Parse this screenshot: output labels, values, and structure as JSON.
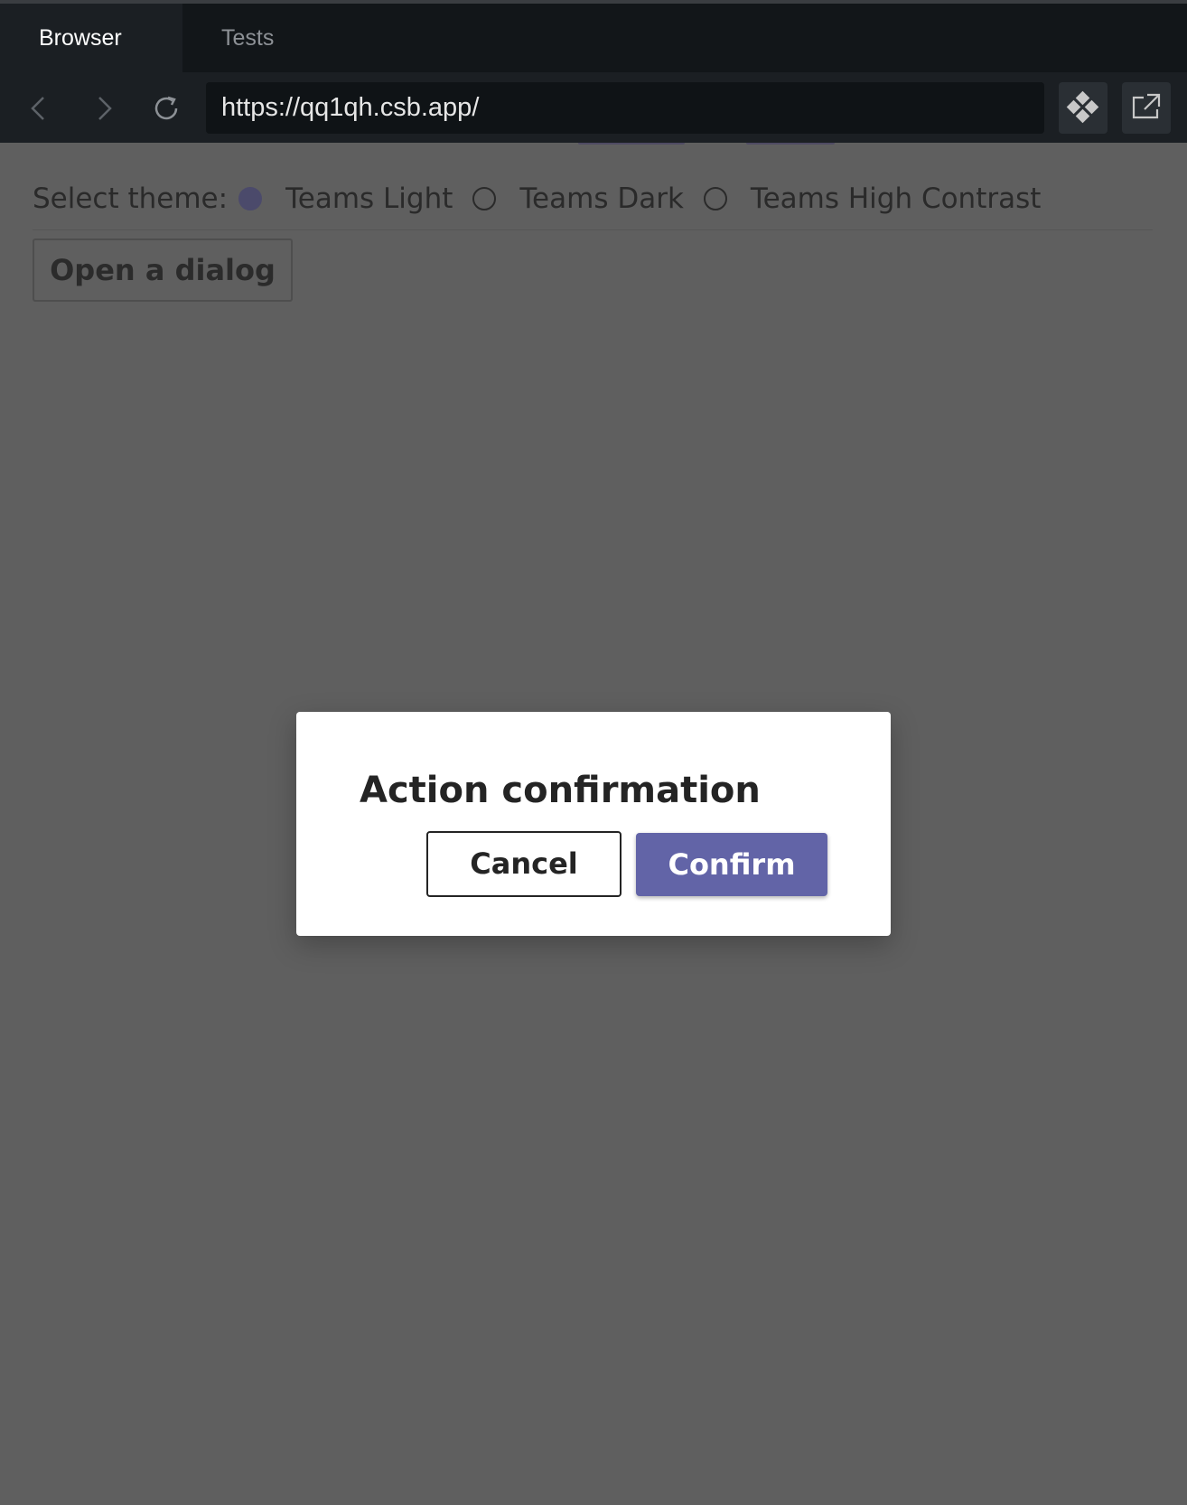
{
  "tabs": [
    {
      "label": "Browser",
      "active": true
    },
    {
      "label": "Tests",
      "active": false
    }
  ],
  "navbar": {
    "url": "https://qq1qh.csb.app/",
    "icons": [
      "back-icon",
      "forward-icon",
      "reload-icon",
      "codesandbox-icon",
      "open-external-icon"
    ]
  },
  "page": {
    "theme_label": "Select theme:",
    "theme_options": [
      {
        "label": "Teams Light",
        "checked": true
      },
      {
        "label": "Teams Dark",
        "checked": false
      },
      {
        "label": "Teams High Contrast",
        "checked": false
      }
    ],
    "open_dialog_label": "Open a dialog"
  },
  "dialog": {
    "title": "Action confirmation",
    "cancel_label": "Cancel",
    "confirm_label": "Confirm",
    "confirm_color": "#6264a7"
  },
  "colors": {
    "overlay": "#5f5f5f",
    "tabbar": "#121619",
    "navbar": "#1b1f23"
  }
}
